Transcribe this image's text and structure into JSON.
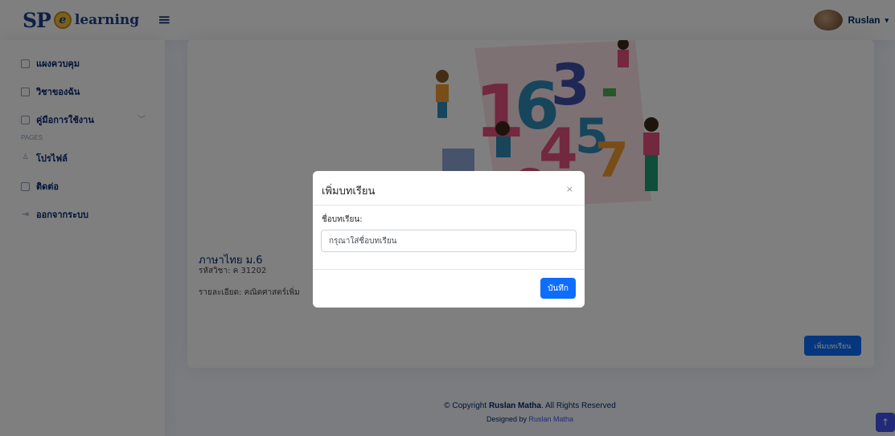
{
  "header": {
    "logo_sp": "SP",
    "logo_e": "e",
    "logo_text": "learning",
    "toggle_icon": "≡",
    "user_name": "Ruslan",
    "user_caret": "▾"
  },
  "sidebar": {
    "items": [
      {
        "label": "แผงควบคุม",
        "icon": "grid-icon"
      },
      {
        "label": "วิชาของฉัน",
        "icon": "grid-icon"
      },
      {
        "label": "คู่มือการใช้งาน",
        "icon": "layout-icon"
      }
    ],
    "section_heading": "PAGES",
    "page_items": [
      {
        "label": "โปรไฟล์",
        "icon": "person-icon"
      },
      {
        "label": "ติดต่อ",
        "icon": "envelope-icon"
      },
      {
        "label": "ออกจากระบบ",
        "icon": "logout-icon"
      }
    ]
  },
  "course": {
    "title": "ภาษาไทย ม.6",
    "code": "รหัสวิชา: ค 31202",
    "detail": "รายละเอียด: คณิตศาสตร์เพิ่ม"
  },
  "main": {
    "add_lesson_label": "เพิ่มบทเรียน"
  },
  "modal": {
    "title": "เพิ่มบทเรียน",
    "close": "×",
    "field_label": "ชื่อบทเรียน:",
    "field_placeholder": "กรุณาใส่ชื่อบทเรียน",
    "save_label": "บันทึก"
  },
  "footer": {
    "copyright_prefix": "© Copyright ",
    "copyright_name": "Ruslan Matha",
    "copyright_suffix": ". All Rights Reserved",
    "designed_prefix": "Designed by ",
    "designed_name": "Ruslan Matha"
  },
  "colors": {
    "primary": "#0d6efd",
    "navy": "#012970",
    "accent": "#4154f1"
  }
}
